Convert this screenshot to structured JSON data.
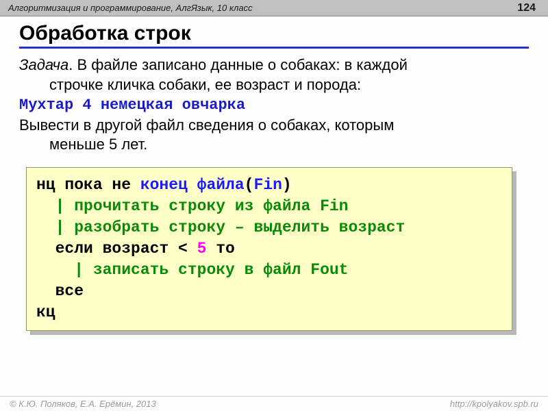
{
  "header": {
    "course": "Алгоритмизация и программирование, АлгЯзык, 10 класс",
    "page_number": "124"
  },
  "title": "Обработка строк",
  "task": {
    "label": "Задача",
    "line1": ". В файле записано данные о собаках: в каждой",
    "line2": "строчке кличка собаки, ее возраст и порода:",
    "example": "Мухтар 4 немецкая овчарка",
    "line3": "Вывести в другой файл сведения о собаках, которым",
    "line4": "меньше 5 лет."
  },
  "code": {
    "l1a": "нц пока не ",
    "l1b": "конец файла",
    "l1c": "(",
    "l1d": "Fin",
    "l1e": ")",
    "l2": "  | прочитать строку из файла Fin",
    "l3": "  | разобрать строку – выделить возраст",
    "l4a": "  если возраст < ",
    "l4b": "5",
    "l4c": " то",
    "l5": "    | записать строку в файл Fout",
    "l6": "  все",
    "l7": "кц"
  },
  "footer": {
    "left": "© К.Ю. Поляков, Е.А. Ерёмин, 2013",
    "right": "http://kpolyakov.spb.ru"
  }
}
